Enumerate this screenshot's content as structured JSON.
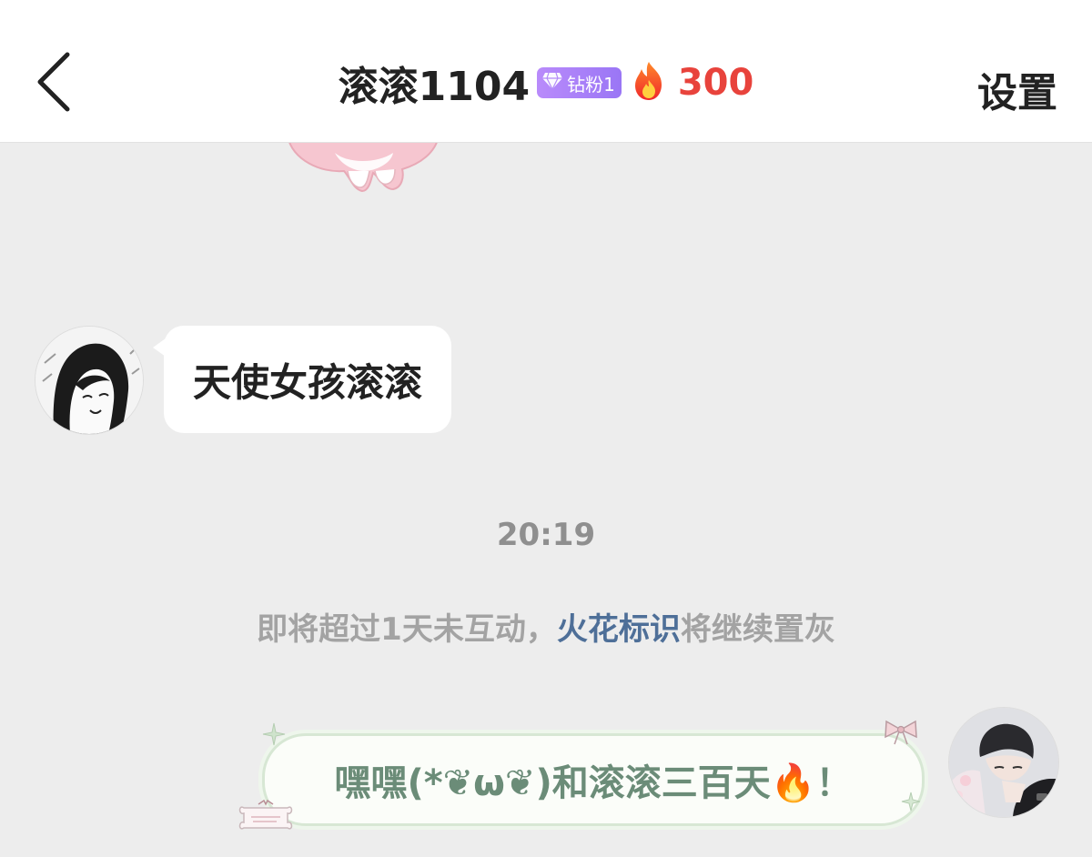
{
  "header": {
    "back_icon": "chevron-left-icon",
    "title": "滚滚1104",
    "fan_badge": "钻粉1",
    "fan_badge_icon": "diamond-icon",
    "spark_icon": "flame-icon",
    "spark_count": "300",
    "settings_label": "设置"
  },
  "messages": {
    "incoming": {
      "text": "天使女孩滚滚"
    },
    "timestamp": "20:19",
    "notice": {
      "prefix": "即将超过1天未互动，",
      "link": "火花标识",
      "suffix": "将继续置灰"
    },
    "outgoing": {
      "text": "嘿嘿(*❦ω❦)和滚滚三百天🔥！"
    }
  },
  "colors": {
    "background": "#ededed",
    "header_bg": "#ffffff",
    "spark_count": "#e8433c",
    "badge_gradient_start": "#b98bfb",
    "badge_gradient_end": "#9a76f5",
    "notice_text": "#a3a3a3",
    "notice_link": "#4e6f98",
    "outgoing_text": "#6b8c78",
    "outgoing_border": "#d7e7d4"
  }
}
